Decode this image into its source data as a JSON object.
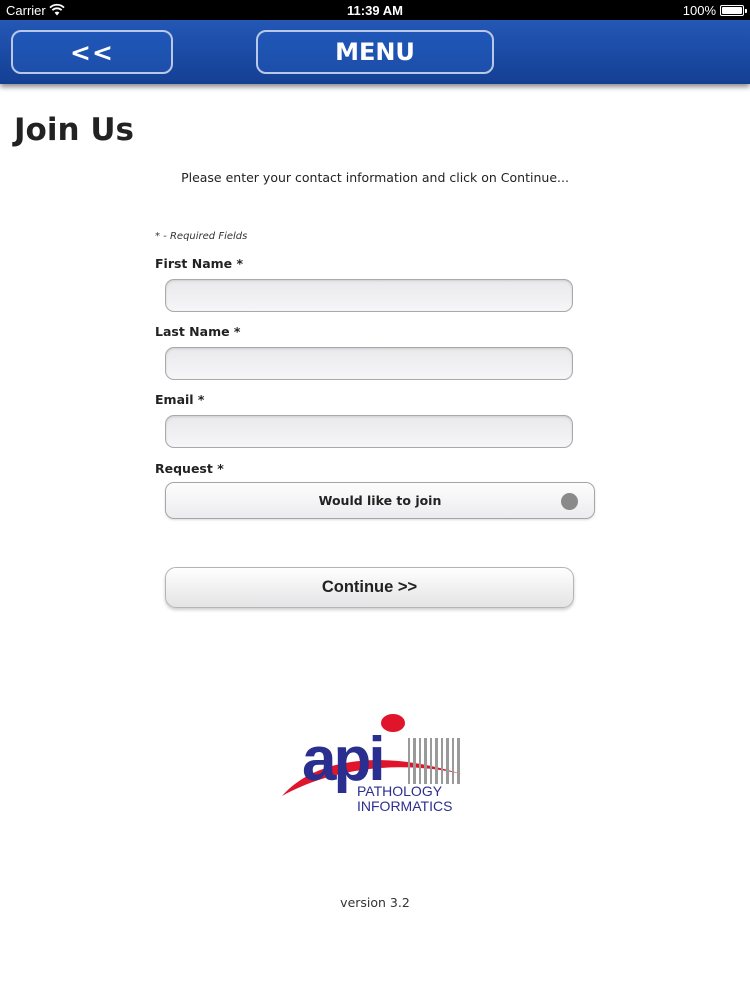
{
  "status_bar": {
    "carrier": "Carrier",
    "time": "11:39 AM",
    "battery": "100%",
    "icons": [
      "wifi-icon",
      "battery-icon"
    ]
  },
  "nav": {
    "back_label": "<<",
    "menu_label": "MENU",
    "color": "#1a4aa4"
  },
  "page": {
    "title": "Join Us",
    "instructions": "Please enter your contact information and click on Continue...",
    "required_note": "* - Required Fields"
  },
  "form": {
    "first_name": {
      "label": "First Name *",
      "value": "",
      "placeholder": ""
    },
    "last_name": {
      "label": "Last Name *",
      "value": "",
      "placeholder": ""
    },
    "email": {
      "label": "Email *",
      "value": "",
      "placeholder": ""
    },
    "request": {
      "label": "Request *",
      "selected": "Would like to join"
    },
    "continue_label": "Continue >>"
  },
  "logo": {
    "mark": "api",
    "line1": "PATHOLOGY",
    "line2": "INFORMATICS",
    "brand_blue": "#2a2f8f",
    "brand_red": "#e0152b"
  },
  "footer": {
    "version": "version 3.2"
  }
}
